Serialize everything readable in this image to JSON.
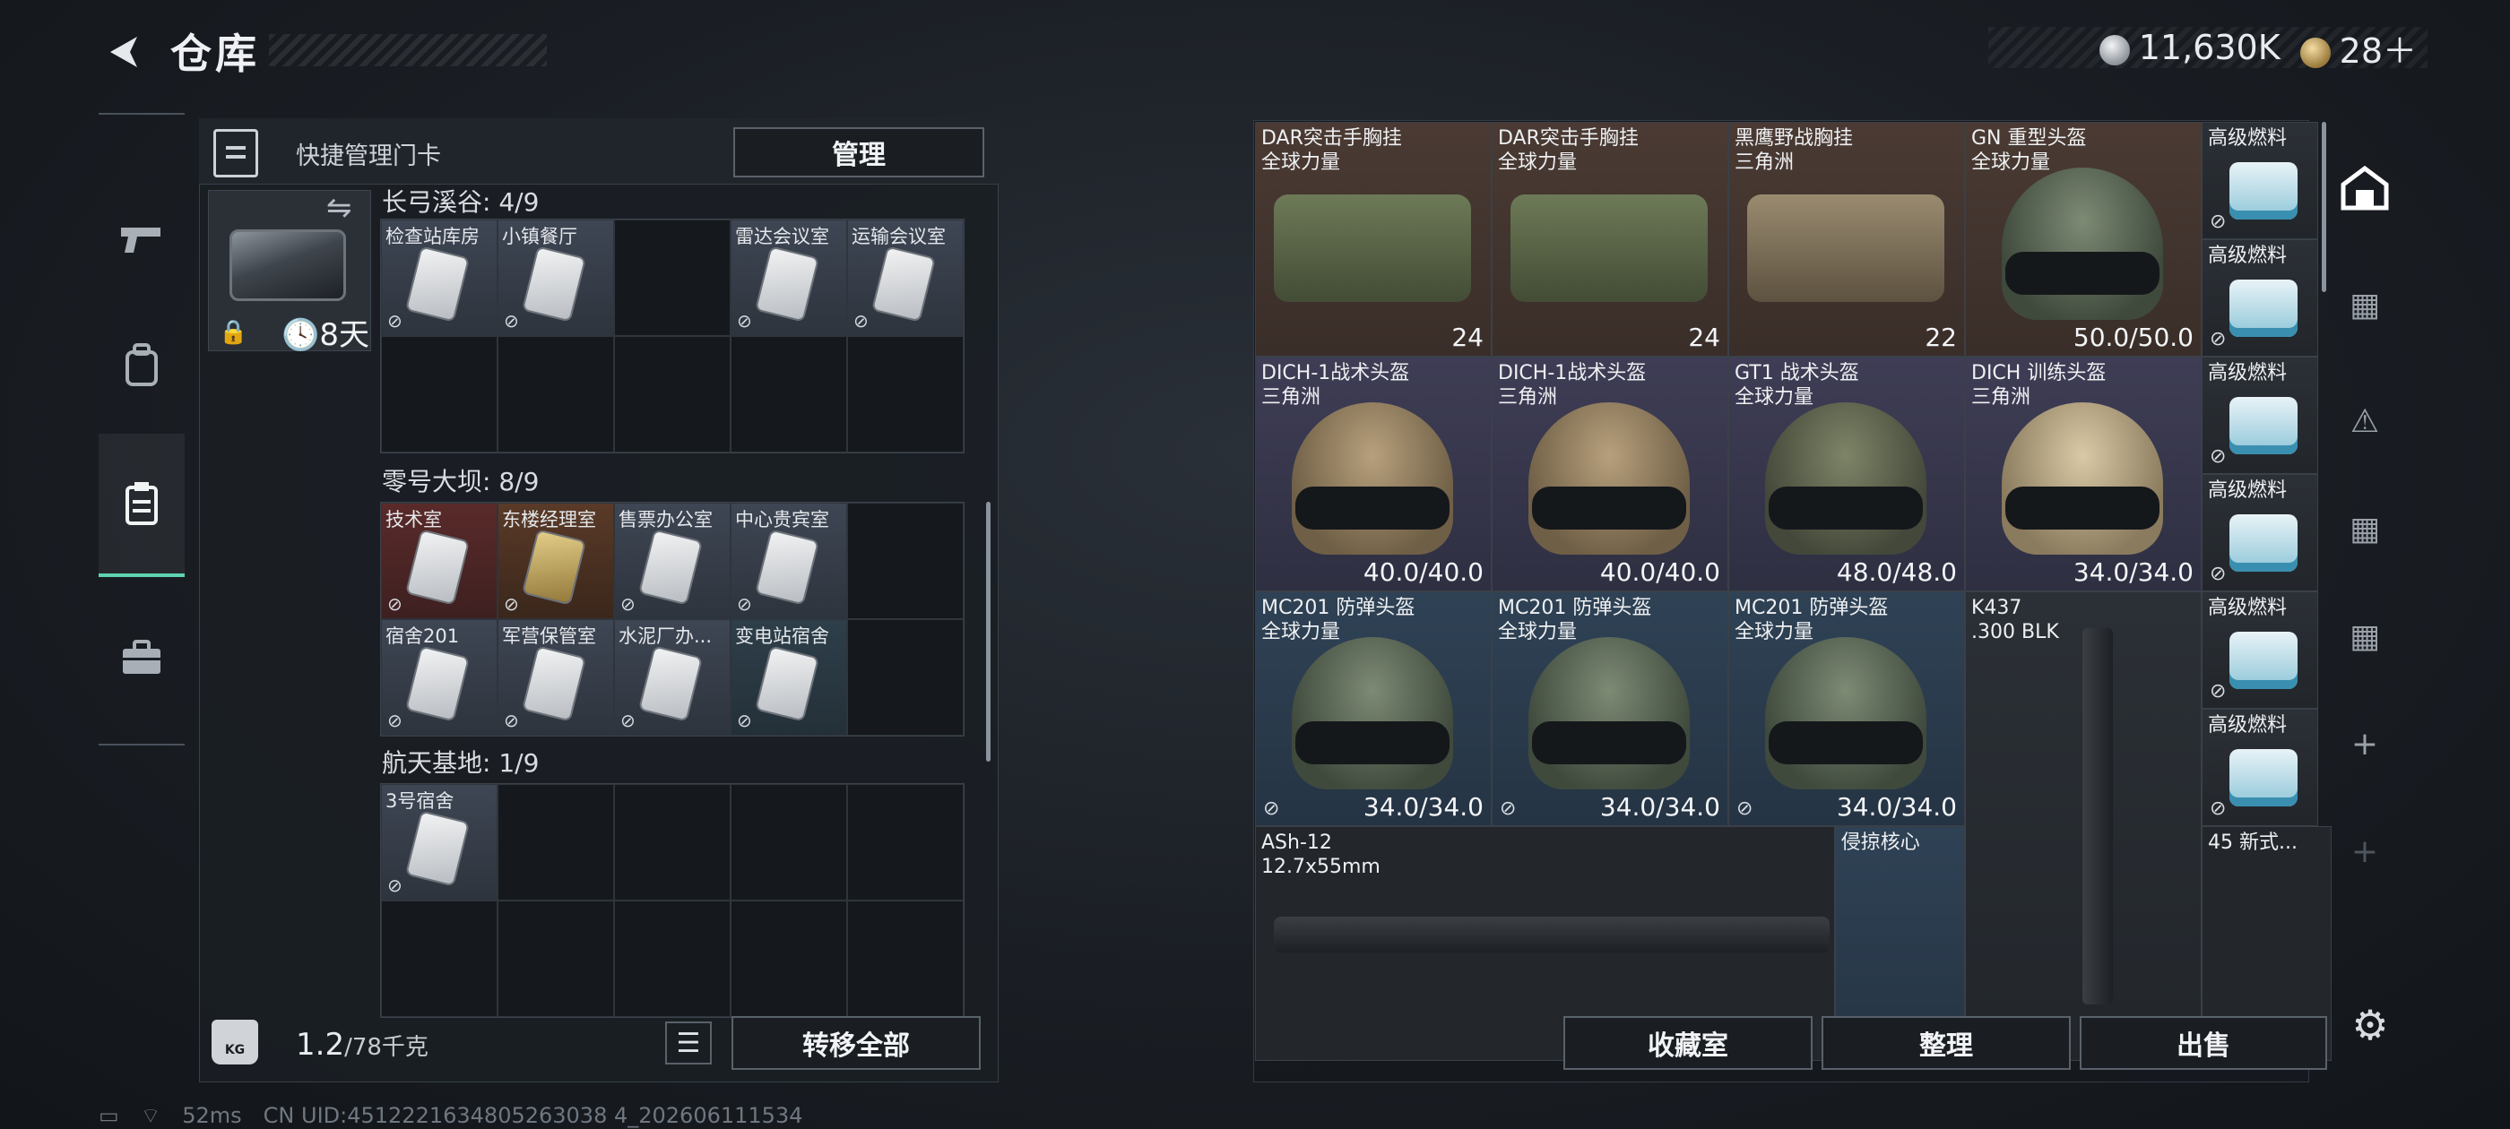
{
  "header": {
    "title": "仓库",
    "currency": [
      {
        "icon": "silver-coin-icon",
        "value": "11,630K"
      },
      {
        "icon": "gold-coin-icon",
        "value": "28＋"
      }
    ]
  },
  "left": {
    "quick_title": "快捷管理门卡",
    "manage_label": "管理",
    "keycard_days": "8天",
    "sections": [
      {
        "title": "长弓溪谷: 4/9",
        "rows": 2,
        "cards": [
          {
            "name": "检查站库房",
            "color": "gray"
          },
          {
            "name": "小镇餐厅",
            "color": "gray"
          },
          {
            "name": "",
            "color": ""
          },
          {
            "name": "雷达会议室",
            "color": "gray"
          },
          {
            "name": "运输会议室",
            "color": "gray"
          }
        ]
      },
      {
        "title": "零号大坝: 8/9",
        "rows": 2,
        "cards": [
          {
            "name": "技术室",
            "color": "red"
          },
          {
            "name": "东楼经理室",
            "color": "gold"
          },
          {
            "name": "售票办公室",
            "color": "gray"
          },
          {
            "name": "中心贵宾室",
            "color": "gray"
          },
          {
            "name": "",
            "color": ""
          },
          {
            "name": "宿舍201",
            "color": "gray"
          },
          {
            "name": "军营保管室",
            "color": "gray"
          },
          {
            "name": "水泥厂办...",
            "color": "gray"
          },
          {
            "name": "变电站宿舍",
            "color": "teal"
          },
          {
            "name": "",
            "color": ""
          }
        ]
      },
      {
        "title": "航天基地: 1/9",
        "rows": 2,
        "cards": [
          {
            "name": "3号宿舍",
            "color": "gray"
          }
        ]
      }
    ],
    "weight_value": "1.2",
    "weight_limit": "/78千克",
    "transfer_label": "转移全部"
  },
  "items": [
    {
      "name": "DAR突击手胸挂",
      "sub": "全球力量",
      "value": "24",
      "color": "brown"
    },
    {
      "name": "DAR突击手胸挂",
      "sub": "全球力量",
      "value": "24",
      "color": "brown"
    },
    {
      "name": "黑鹰野战胸挂",
      "sub": "三角洲",
      "value": "22",
      "color": "brown"
    },
    {
      "name": "GN 重型头盔",
      "sub": "全球力量",
      "value": "50.0/50.0",
      "color": "brown"
    },
    {
      "name": "DICH-1战术头盔",
      "sub": "三角洲",
      "value": "40.0/40.0",
      "color": "purple"
    },
    {
      "name": "DICH-1战术头盔",
      "sub": "三角洲",
      "value": "40.0/40.0",
      "color": "purple"
    },
    {
      "name": "GT1 战术头盔",
      "sub": "全球力量",
      "value": "48.0/48.0",
      "color": "purple"
    },
    {
      "name": "DICH 训练头盔",
      "sub": "三角洲",
      "value": "34.0/34.0",
      "color": "purple"
    },
    {
      "name": "MC201 防弹头盔",
      "sub": "全球力量",
      "value": "34.0/34.0",
      "color": "blue"
    },
    {
      "name": "MC201 防弹头盔",
      "sub": "全球力量",
      "value": "34.0/34.0",
      "color": "blue"
    },
    {
      "name": "MC201 防弹头盔",
      "sub": "全球力量",
      "value": "34.0/34.0",
      "color": "blue"
    },
    {
      "name": "K437",
      "sub": ".300 BLK",
      "value": "",
      "color": "dark"
    },
    {
      "name": "ASh-12",
      "sub": "12.7x55mm",
      "value": "",
      "color": "neutral"
    },
    {
      "name": "侵掠核心",
      "sub": "",
      "value": "",
      "color": "blue"
    },
    {
      "name": "45 新式...",
      "sub": "",
      "value": "",
      "color": "neutral"
    }
  ],
  "fuel_label": "高级燃料",
  "actions": {
    "collection": "收藏室",
    "sort": "整理",
    "sell": "出售"
  },
  "status": {
    "ping": "52ms",
    "uid": "CN UID:4512221634805263038 4_202606111534"
  }
}
